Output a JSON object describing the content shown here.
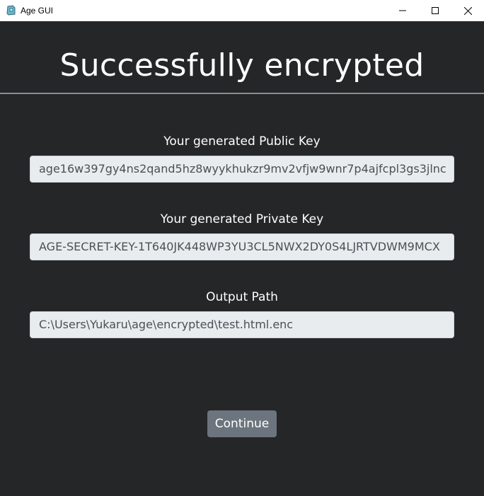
{
  "window": {
    "title": "Age GUI",
    "icon": "app-icon",
    "controls": [
      "minimize-icon",
      "maximize-icon",
      "close-icon"
    ]
  },
  "header": {
    "title": "Successfully encrypted"
  },
  "fields": {
    "public_key": {
      "label": "Your generated Public Key",
      "value": "age16w397gy4ns2qand5hz8wyykhukzr9mv2vfjw9wnr7p4ajfcpl3gs3jlnc"
    },
    "private_key": {
      "label": "Your generated Private Key",
      "value": "AGE-SECRET-KEY-1T640JK448WP3YU3CL5NWX2DY0S4LJRTVDWM9MCX"
    },
    "output_path": {
      "label": "Output Path",
      "value": "C:\\Users\\Yukaru\\age\\encrypted\\test.html.enc"
    }
  },
  "actions": {
    "continue_label": "Continue"
  },
  "colors": {
    "background": "#242628",
    "field_background": "#e9ecef",
    "field_text": "#495057",
    "button_background": "#6c757d",
    "divider": "#8a8d90"
  }
}
